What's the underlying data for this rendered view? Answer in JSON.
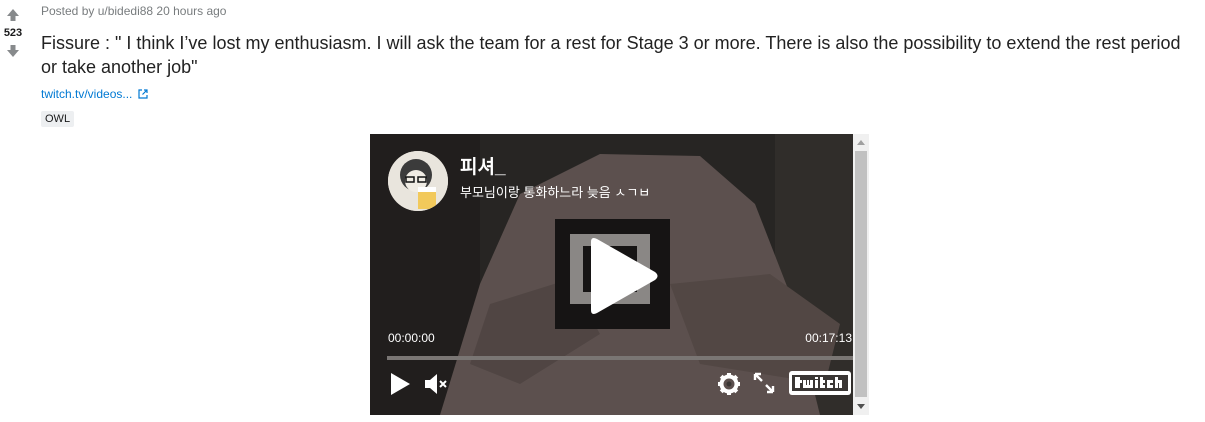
{
  "vote": {
    "score": "523",
    "upvote_icon": "arrow-up-icon",
    "downvote_icon": "arrow-down-icon"
  },
  "post": {
    "meta": "Posted by u/bidedi88 20 hours ago",
    "title": "Fissure : \" I think I’ve lost my enthusiasm. I will ask the team for a rest for Stage 3 or more. There is also the possibility to extend the rest period or take another job\"",
    "link_text": "twitch.tv/videos...",
    "link_icon": "external-link-icon",
    "flair": "OWL"
  },
  "player": {
    "channel_name": "피셔_",
    "status": "부모님이랑 통화하느라 늦음 ㅅㄱㅂ",
    "time_current": "00:00:00",
    "time_total": "00:17:13",
    "progress": 0,
    "brand": "twitch",
    "icons": [
      "play-icon",
      "mute-icon",
      "settings-icon",
      "fullscreen-icon",
      "twitch-logo"
    ]
  },
  "colors": {
    "link": "#0079d3",
    "meta": "#787c7e",
    "flair_bg": "#edeff1",
    "player_bg": "#3a3634"
  }
}
